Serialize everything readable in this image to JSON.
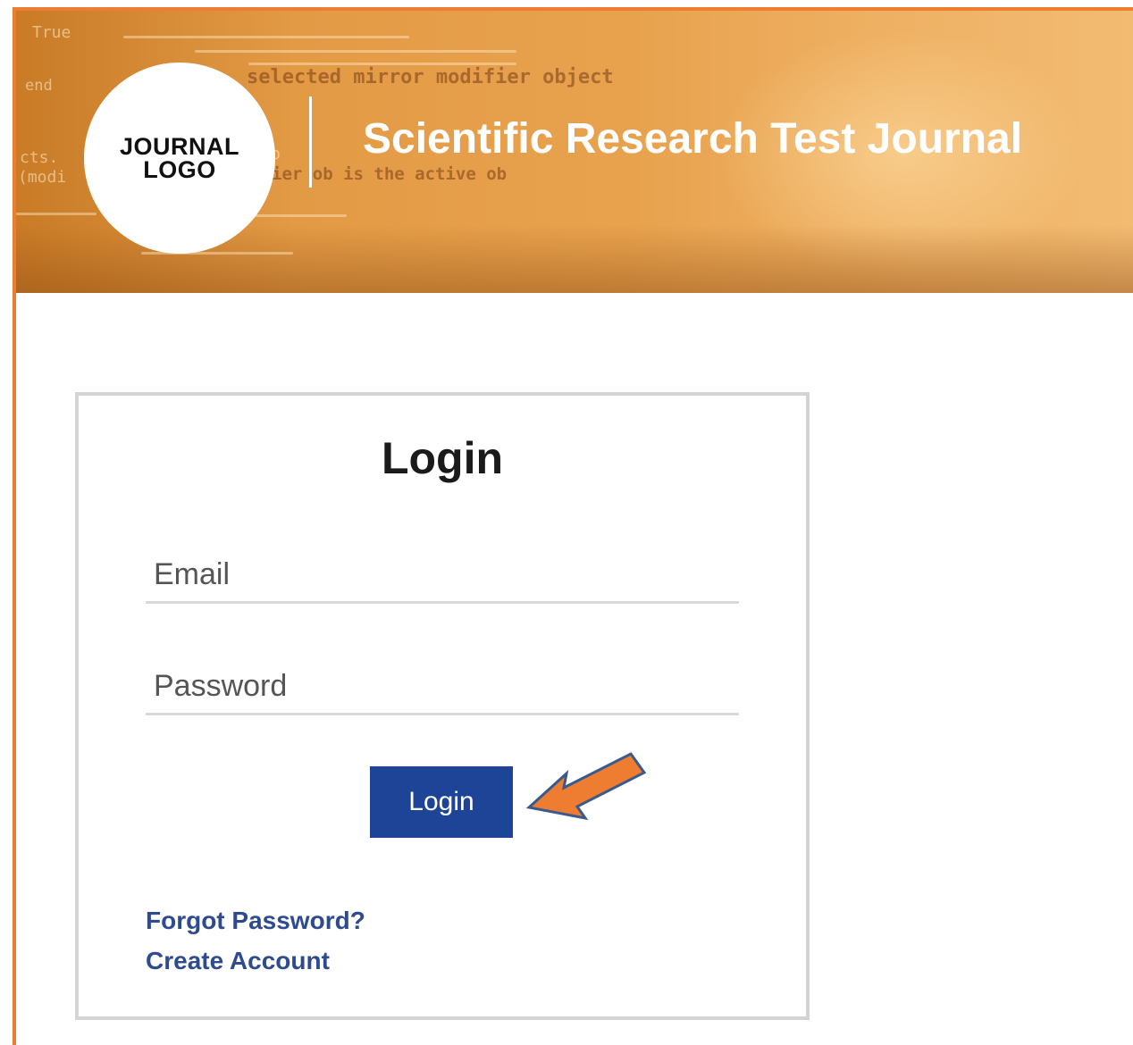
{
  "banner": {
    "logo_text_line1": "JOURNAL",
    "logo_text_line2": "LOGO",
    "journal_title": "Scientific Research Test Journal",
    "code_text": {
      "true": "True",
      "end": "end",
      "selected_mirror": "selected mirror modifier object",
      "cts": "cts.",
      "modi": "(modi",
      "active": "ier ob is the active ob",
      "ob": "ob"
    }
  },
  "login": {
    "heading": "Login",
    "email_placeholder": "Email",
    "password_placeholder": "Password",
    "button_label": "Login",
    "forgot_password": "Forgot Password?",
    "create_account": "Create Account"
  },
  "colors": {
    "frame_border": "#ee7d31",
    "button_bg": "#1d4496",
    "link": "#2f4b8f",
    "arrow_fill": "#ee7d31",
    "arrow_stroke": "#3a5a8c"
  },
  "icons": {
    "annotation_arrow": "pointing-arrow-icon"
  }
}
